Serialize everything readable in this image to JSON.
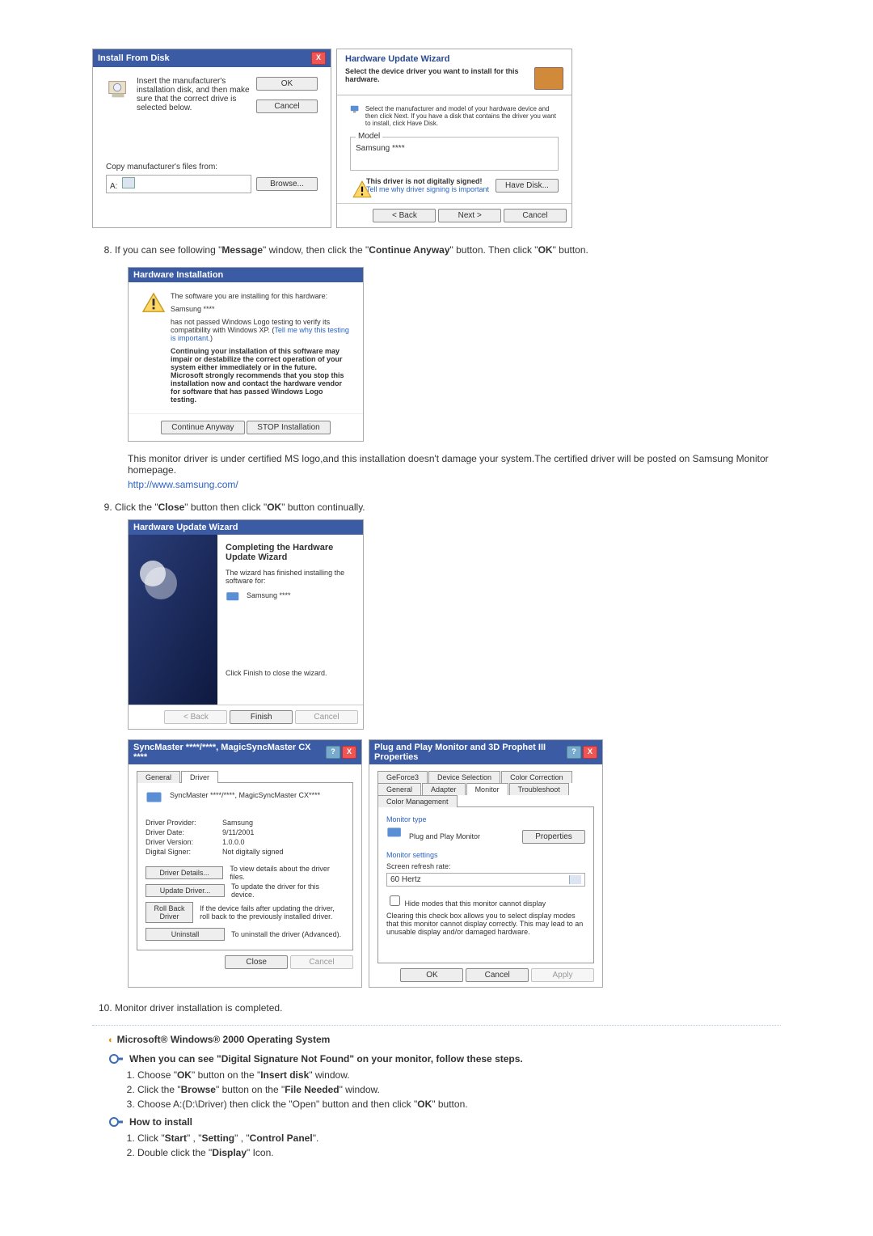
{
  "install_from_disk": {
    "title": "Install From Disk",
    "instr": "Insert the manufacturer's installation disk, and then make sure that the correct drive is selected below.",
    "ok": "OK",
    "cancel": "Cancel",
    "copy_label": "Copy manufacturer's files from:",
    "path": "A:",
    "browse": "Browse..."
  },
  "hw_update": {
    "title": "Hardware Update Wizard",
    "sub": "Select the device driver you want to install for this hardware.",
    "instr": "Select the manufacturer and model of your hardware device and then click Next. If you have a disk that contains the driver you want to install, click Have Disk.",
    "model_lbl": "Model",
    "model_val": "Samsung ****",
    "not_signed": "This driver is not digitally signed!",
    "why": "Tell me why driver signing is important",
    "have": "Have Disk...",
    "back": "< Back",
    "next": "Next >",
    "cancel": "Cancel"
  },
  "step8_pre": "8.",
  "step8_text_a": "If you can see following \"",
  "step8_text_b": "\" window, then click the \"",
  "step8_text_c": "\" button. Then click \"",
  "step8_text_d": "\" button.",
  "step8_msg": "Message",
  "step8_btn1": "Continue Anyway",
  "step8_btn2": "OK",
  "hw_install": {
    "title": "Hardware Installation",
    "l1": "The software you are installing for this hardware:",
    "l2": "Samsung ****",
    "l3a": "has not passed Windows Logo testing to verify its compatibility with Windows XP. (",
    "l3_link": "Tell me why this testing is important.",
    "l3b": ")",
    "warn": "Continuing your installation of this software may impair or destabilize the correct operation of your system either immediately or in the future. Microsoft strongly recommends that you stop this installation now and contact the hardware vendor for software that has passed Windows Logo testing.",
    "cont": "Continue Anyway",
    "stop": "STOP Installation"
  },
  "mid_para": "This monitor driver is under certified MS logo,and this installation doesn't damage your system.The certified driver will be posted on Samsung Monitor homepage.",
  "samsung_url": "http://www.samsung.com/",
  "step9_pre": "9.",
  "step9_a": "Click the \"",
  "step9_close": "Close",
  "step9_b": "\" button then click \"",
  "step9_ok": "OK",
  "step9_c": "\" button continually.",
  "wizard_done": {
    "title": "Hardware Update Wizard",
    "h": "Completing the Hardware Update Wizard",
    "p": "The wizard has finished installing the software for:",
    "dev": "Samsung ****",
    "fin_txt": "Click Finish to close the wizard.",
    "back": "< Back",
    "finish": "Finish",
    "cancel": "Cancel"
  },
  "driver_props": {
    "title": "SyncMaster ****/****, MagicSyncMaster CX ****",
    "tab_gen": "General",
    "tab_drv": "Driver",
    "dev": "SyncMaster ****/****, MagicSyncMaster CX****",
    "rows": {
      "prov_k": "Driver Provider:",
      "prov_v": "Samsung",
      "date_k": "Driver Date:",
      "date_v": "9/11/2001",
      "ver_k": "Driver Version:",
      "ver_v": "1.0.0.0",
      "sign_k": "Digital Signer:",
      "sign_v": "Not digitally signed"
    },
    "b1": "Driver Details...",
    "b1t": "To view details about the driver files.",
    "b2": "Update Driver...",
    "b2t": "To update the driver for this device.",
    "b3": "Roll Back Driver",
    "b3t": "If the device fails after updating the driver, roll back to the previously installed driver.",
    "b4": "Uninstall",
    "b4t": "To uninstall the driver (Advanced).",
    "close": "Close",
    "cancel": "Cancel"
  },
  "pnp": {
    "title": "Plug and Play Monitor and 3D Prophet III Properties",
    "tabs": [
      "GeForce3",
      "Device Selection",
      "Color Correction",
      "General",
      "Adapter",
      "Monitor",
      "Troubleshoot",
      "Color Management"
    ],
    "mt_lbl": "Monitor type",
    "mt_val": "Plug and Play Monitor",
    "props": "Properties",
    "ms_lbl": "Monitor settings",
    "rr_lbl": "Screen refresh rate:",
    "rr_val": "60 Hertz",
    "hide_cb": "Hide modes that this monitor cannot display",
    "hide_txt": "Clearing this check box allows you to select display modes that this monitor cannot display correctly. This may lead to an unusable display and/or damaged hardware.",
    "ok": "OK",
    "cancel": "Cancel",
    "apply": "Apply"
  },
  "step10_pre": "10.",
  "step10": "Monitor driver installation is completed.",
  "os2000": "Microsoft® Windows® 2000 Operating System",
  "sig_not_found": "When you can see \"Digital Signature Not Found\" on your monitor, follow these steps.",
  "w2k_a": {
    "1a": "Choose \"",
    "1b": "\" button on the \"",
    "1c": "\" window.",
    "ok": "OK",
    "ins": "Insert disk",
    "2a": "Click the \"",
    "2b": "\" button on the \"",
    "2c": "\" window.",
    "br": "Browse",
    "fn": "File Needed",
    "3a": "Choose A:(D:\\Driver) then click the \"Open\" button and then click \"",
    "3b": "\" button."
  },
  "how_install": "How to install",
  "w2k_b": {
    "1a": "Click \"",
    "start": "Start",
    "sep": "\" , \"",
    "setting": "Setting",
    "cp": "Control Panel",
    "end": "\".",
    "2a": "Double click the \"",
    "disp": "Display",
    "2b": "\" Icon."
  }
}
